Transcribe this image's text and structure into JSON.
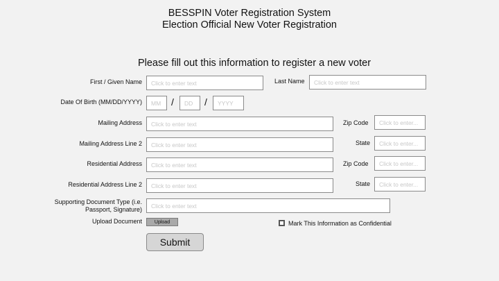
{
  "header": {
    "title": "BESSPIN Voter Registration System",
    "subtitle": "Election Official New Voter Registration",
    "instruction": "Please fill out this information to register a new voter"
  },
  "form": {
    "first_name": {
      "label": "First / Given Name",
      "value": "",
      "placeholder": "Click to enter text"
    },
    "last_name": {
      "label": "Last Name",
      "value": "",
      "placeholder": "Click to enter text"
    },
    "dob": {
      "label": "Date Of Birth (MM/DD/YYYY)",
      "separator": "/",
      "month_placeholder": "MM",
      "day_placeholder": "DD",
      "year_placeholder": "YYYY"
    },
    "mailing_address": {
      "label": "Mailing Address",
      "value": "",
      "placeholder": "Click to enter text"
    },
    "mailing_zip": {
      "label": "Zip Code",
      "value": "",
      "placeholder": "Click to enter..."
    },
    "mailing_address_2": {
      "label": "Mailing Address Line 2",
      "value": "",
      "placeholder": "Click to enter text"
    },
    "mailing_state": {
      "label": "State",
      "value": "",
      "placeholder": "Click to enter..."
    },
    "residential_address": {
      "label": "Residential Address",
      "value": "",
      "placeholder": "Click to enter text"
    },
    "residential_zip": {
      "label": "Zip Code",
      "value": "",
      "placeholder": "Click to enter..."
    },
    "residential_address_2": {
      "label": "Residential Address Line 2",
      "value": "",
      "placeholder": "Click to enter text"
    },
    "residential_state": {
      "label": "State",
      "value": "",
      "placeholder": "Click to enter..."
    },
    "supporting_doc": {
      "label_line1": "Supporting Document Type (i.e.",
      "label_line2": "Passport, Signature)",
      "value": "",
      "placeholder": "Click to enter text"
    },
    "upload": {
      "label": "Upload Document",
      "button_label": "Upload"
    },
    "confidential": {
      "label": "Mark This Information as Confidential",
      "checked": false
    },
    "submit_label": "Submit"
  }
}
